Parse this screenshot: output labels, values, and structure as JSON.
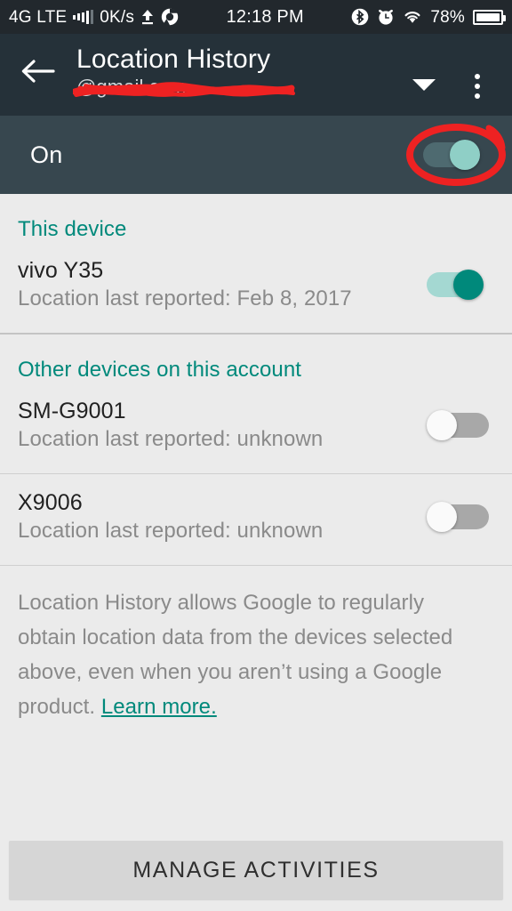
{
  "statusbar": {
    "network": "4G LTE",
    "data_rate": "0K/s",
    "upload_icon": "upload-arrow-icon",
    "chrome_icon": "chrome-icon",
    "signal_icon": "signal-bars-icon",
    "time": "12:18 PM",
    "bluetooth_icon": "bluetooth-icon",
    "alarm_icon": "alarm-clock-icon",
    "wifi_icon": "wifi-icon",
    "battery_percent": "78%",
    "battery_icon": "battery-icon"
  },
  "toolbar": {
    "back_icon": "back-arrow-icon",
    "title": "Location History",
    "account": "@gmail.com",
    "account_redacted": true,
    "dropdown_icon": "chevron-down-icon",
    "overflow_icon": "overflow-menu-icon"
  },
  "master_toggle": {
    "label": "On",
    "state": "on",
    "highlighted": true,
    "highlight_color": "#ee2222"
  },
  "sections": [
    {
      "heading": "This device",
      "devices": [
        {
          "name": "vivo Y35",
          "status": "Location last reported: Feb 8, 2017",
          "toggle": "on"
        }
      ]
    },
    {
      "heading": "Other devices on this account",
      "devices": [
        {
          "name": "SM-G9001",
          "status": "Location last reported: unknown",
          "toggle": "off"
        },
        {
          "name": "X9006",
          "status": "Location last reported: unknown",
          "toggle": "off"
        }
      ]
    }
  ],
  "description": {
    "text": "Location History allows Google to regularly obtain location data from the devices selected above, even when you aren’t using a Google product. ",
    "link_text": "Learn more."
  },
  "bottom": {
    "manage_label": "MANAGE ACTIVITIES"
  },
  "colors": {
    "accent_teal": "#00897b",
    "toolbar_dark": "#253139",
    "onrow_dark": "#37474f",
    "content_gray": "#ebebeb",
    "annotation_red": "#ee2222"
  }
}
